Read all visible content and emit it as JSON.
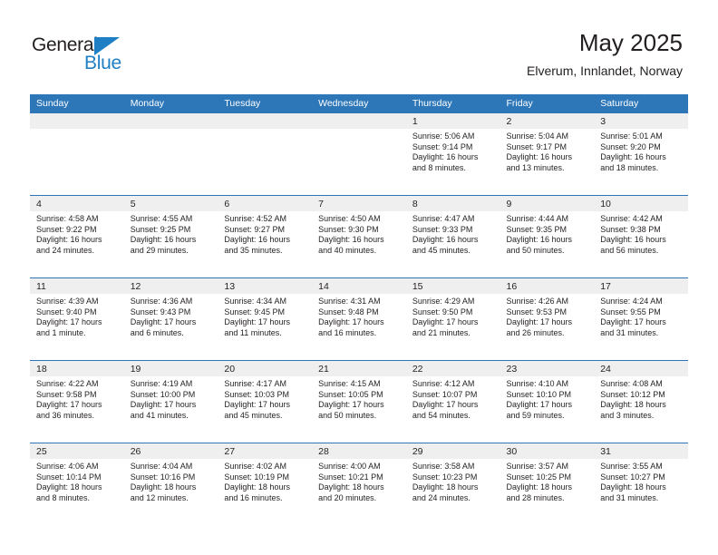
{
  "brand": {
    "name_part1": "General",
    "name_part2": "Blue",
    "triangle_icon": "triangle-icon",
    "colors": {
      "black": "#231f20",
      "blue": "#1f7fc4"
    }
  },
  "header": {
    "title": "May 2025",
    "subtitle": "Elverum, Innlandet, Norway"
  },
  "colors": {
    "header_blue": "#2d76b8",
    "daynum_band": "#efefef",
    "text": "#231f20"
  },
  "weekdays": [
    "Sunday",
    "Monday",
    "Tuesday",
    "Wednesday",
    "Thursday",
    "Friday",
    "Saturday"
  ],
  "weeks": [
    [
      {
        "day": "",
        "lines": []
      },
      {
        "day": "",
        "lines": []
      },
      {
        "day": "",
        "lines": []
      },
      {
        "day": "",
        "lines": []
      },
      {
        "day": "1",
        "lines": [
          "Sunrise: 5:06 AM",
          "Sunset: 9:14 PM",
          "Daylight: 16 hours",
          "and 8 minutes."
        ]
      },
      {
        "day": "2",
        "lines": [
          "Sunrise: 5:04 AM",
          "Sunset: 9:17 PM",
          "Daylight: 16 hours",
          "and 13 minutes."
        ]
      },
      {
        "day": "3",
        "lines": [
          "Sunrise: 5:01 AM",
          "Sunset: 9:20 PM",
          "Daylight: 16 hours",
          "and 18 minutes."
        ]
      }
    ],
    [
      {
        "day": "4",
        "lines": [
          "Sunrise: 4:58 AM",
          "Sunset: 9:22 PM",
          "Daylight: 16 hours",
          "and 24 minutes."
        ]
      },
      {
        "day": "5",
        "lines": [
          "Sunrise: 4:55 AM",
          "Sunset: 9:25 PM",
          "Daylight: 16 hours",
          "and 29 minutes."
        ]
      },
      {
        "day": "6",
        "lines": [
          "Sunrise: 4:52 AM",
          "Sunset: 9:27 PM",
          "Daylight: 16 hours",
          "and 35 minutes."
        ]
      },
      {
        "day": "7",
        "lines": [
          "Sunrise: 4:50 AM",
          "Sunset: 9:30 PM",
          "Daylight: 16 hours",
          "and 40 minutes."
        ]
      },
      {
        "day": "8",
        "lines": [
          "Sunrise: 4:47 AM",
          "Sunset: 9:33 PM",
          "Daylight: 16 hours",
          "and 45 minutes."
        ]
      },
      {
        "day": "9",
        "lines": [
          "Sunrise: 4:44 AM",
          "Sunset: 9:35 PM",
          "Daylight: 16 hours",
          "and 50 minutes."
        ]
      },
      {
        "day": "10",
        "lines": [
          "Sunrise: 4:42 AM",
          "Sunset: 9:38 PM",
          "Daylight: 16 hours",
          "and 56 minutes."
        ]
      }
    ],
    [
      {
        "day": "11",
        "lines": [
          "Sunrise: 4:39 AM",
          "Sunset: 9:40 PM",
          "Daylight: 17 hours",
          "and 1 minute."
        ]
      },
      {
        "day": "12",
        "lines": [
          "Sunrise: 4:36 AM",
          "Sunset: 9:43 PM",
          "Daylight: 17 hours",
          "and 6 minutes."
        ]
      },
      {
        "day": "13",
        "lines": [
          "Sunrise: 4:34 AM",
          "Sunset: 9:45 PM",
          "Daylight: 17 hours",
          "and 11 minutes."
        ]
      },
      {
        "day": "14",
        "lines": [
          "Sunrise: 4:31 AM",
          "Sunset: 9:48 PM",
          "Daylight: 17 hours",
          "and 16 minutes."
        ]
      },
      {
        "day": "15",
        "lines": [
          "Sunrise: 4:29 AM",
          "Sunset: 9:50 PM",
          "Daylight: 17 hours",
          "and 21 minutes."
        ]
      },
      {
        "day": "16",
        "lines": [
          "Sunrise: 4:26 AM",
          "Sunset: 9:53 PM",
          "Daylight: 17 hours",
          "and 26 minutes."
        ]
      },
      {
        "day": "17",
        "lines": [
          "Sunrise: 4:24 AM",
          "Sunset: 9:55 PM",
          "Daylight: 17 hours",
          "and 31 minutes."
        ]
      }
    ],
    [
      {
        "day": "18",
        "lines": [
          "Sunrise: 4:22 AM",
          "Sunset: 9:58 PM",
          "Daylight: 17 hours",
          "and 36 minutes."
        ]
      },
      {
        "day": "19",
        "lines": [
          "Sunrise: 4:19 AM",
          "Sunset: 10:00 PM",
          "Daylight: 17 hours",
          "and 41 minutes."
        ]
      },
      {
        "day": "20",
        "lines": [
          "Sunrise: 4:17 AM",
          "Sunset: 10:03 PM",
          "Daylight: 17 hours",
          "and 45 minutes."
        ]
      },
      {
        "day": "21",
        "lines": [
          "Sunrise: 4:15 AM",
          "Sunset: 10:05 PM",
          "Daylight: 17 hours",
          "and 50 minutes."
        ]
      },
      {
        "day": "22",
        "lines": [
          "Sunrise: 4:12 AM",
          "Sunset: 10:07 PM",
          "Daylight: 17 hours",
          "and 54 minutes."
        ]
      },
      {
        "day": "23",
        "lines": [
          "Sunrise: 4:10 AM",
          "Sunset: 10:10 PM",
          "Daylight: 17 hours",
          "and 59 minutes."
        ]
      },
      {
        "day": "24",
        "lines": [
          "Sunrise: 4:08 AM",
          "Sunset: 10:12 PM",
          "Daylight: 18 hours",
          "and 3 minutes."
        ]
      }
    ],
    [
      {
        "day": "25",
        "lines": [
          "Sunrise: 4:06 AM",
          "Sunset: 10:14 PM",
          "Daylight: 18 hours",
          "and 8 minutes."
        ]
      },
      {
        "day": "26",
        "lines": [
          "Sunrise: 4:04 AM",
          "Sunset: 10:16 PM",
          "Daylight: 18 hours",
          "and 12 minutes."
        ]
      },
      {
        "day": "27",
        "lines": [
          "Sunrise: 4:02 AM",
          "Sunset: 10:19 PM",
          "Daylight: 18 hours",
          "and 16 minutes."
        ]
      },
      {
        "day": "28",
        "lines": [
          "Sunrise: 4:00 AM",
          "Sunset: 10:21 PM",
          "Daylight: 18 hours",
          "and 20 minutes."
        ]
      },
      {
        "day": "29",
        "lines": [
          "Sunrise: 3:58 AM",
          "Sunset: 10:23 PM",
          "Daylight: 18 hours",
          "and 24 minutes."
        ]
      },
      {
        "day": "30",
        "lines": [
          "Sunrise: 3:57 AM",
          "Sunset: 10:25 PM",
          "Daylight: 18 hours",
          "and 28 minutes."
        ]
      },
      {
        "day": "31",
        "lines": [
          "Sunrise: 3:55 AM",
          "Sunset: 10:27 PM",
          "Daylight: 18 hours",
          "and 31 minutes."
        ]
      }
    ]
  ]
}
